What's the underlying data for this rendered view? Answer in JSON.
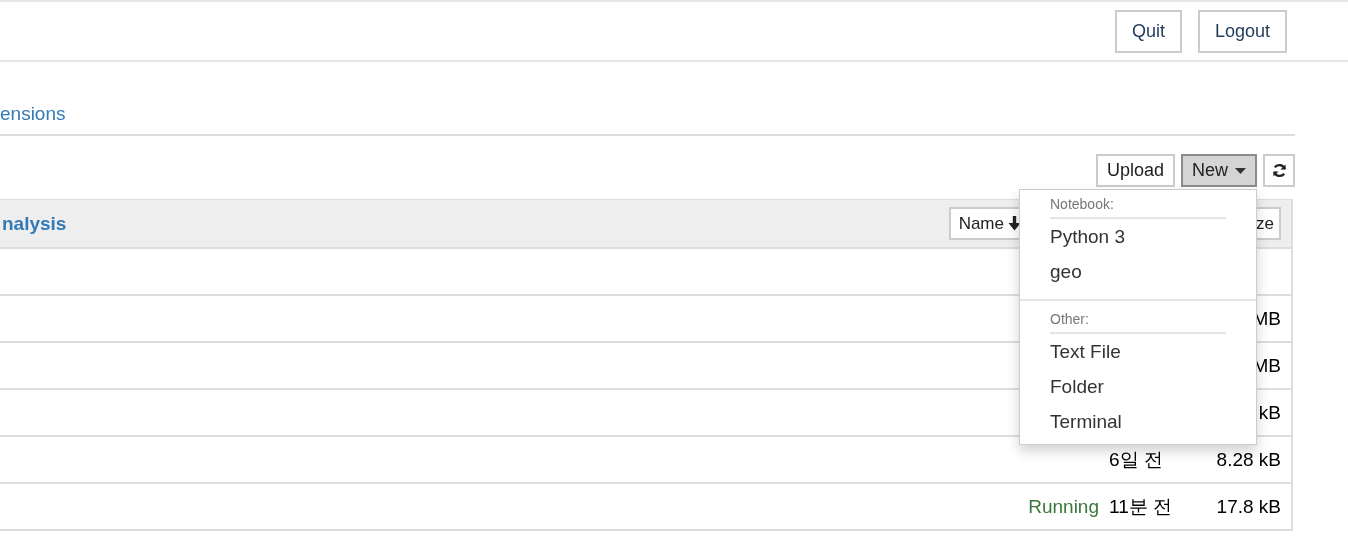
{
  "header": {
    "buttons": [
      {
        "label": "Quit"
      },
      {
        "label": "Logout"
      }
    ]
  },
  "tab_link": "ensions",
  "toolbar": {
    "buttons": [
      {
        "kind": "text",
        "label": "Upload",
        "pressed": false
      },
      {
        "kind": "dropdown",
        "label": "New",
        "pressed": true
      },
      {
        "kind": "refresh",
        "pressed": false
      }
    ]
  },
  "file_list": {
    "breadcrumb": "nalysis",
    "sort_buttons": [
      {
        "label": "Name",
        "sorted": true
      },
      {
        "label": "ze",
        "sorted": false
      }
    ],
    "rows": [
      {},
      {
        "size": "MB"
      },
      {
        "size": "MB"
      },
      {
        "size": "kB"
      },
      {
        "modified": "6일 전",
        "size": "8.28 kB"
      },
      {
        "status": "Running",
        "modified": "11분 전",
        "size": "17.8 kB"
      }
    ]
  },
  "new_menu": {
    "open": true,
    "sections": [
      {
        "header": "Notebook:",
        "items": [
          "Python 3",
          "geo"
        ]
      },
      {
        "header": "Other:",
        "items": [
          "Text File",
          "Folder",
          "Terminal"
        ]
      }
    ]
  }
}
